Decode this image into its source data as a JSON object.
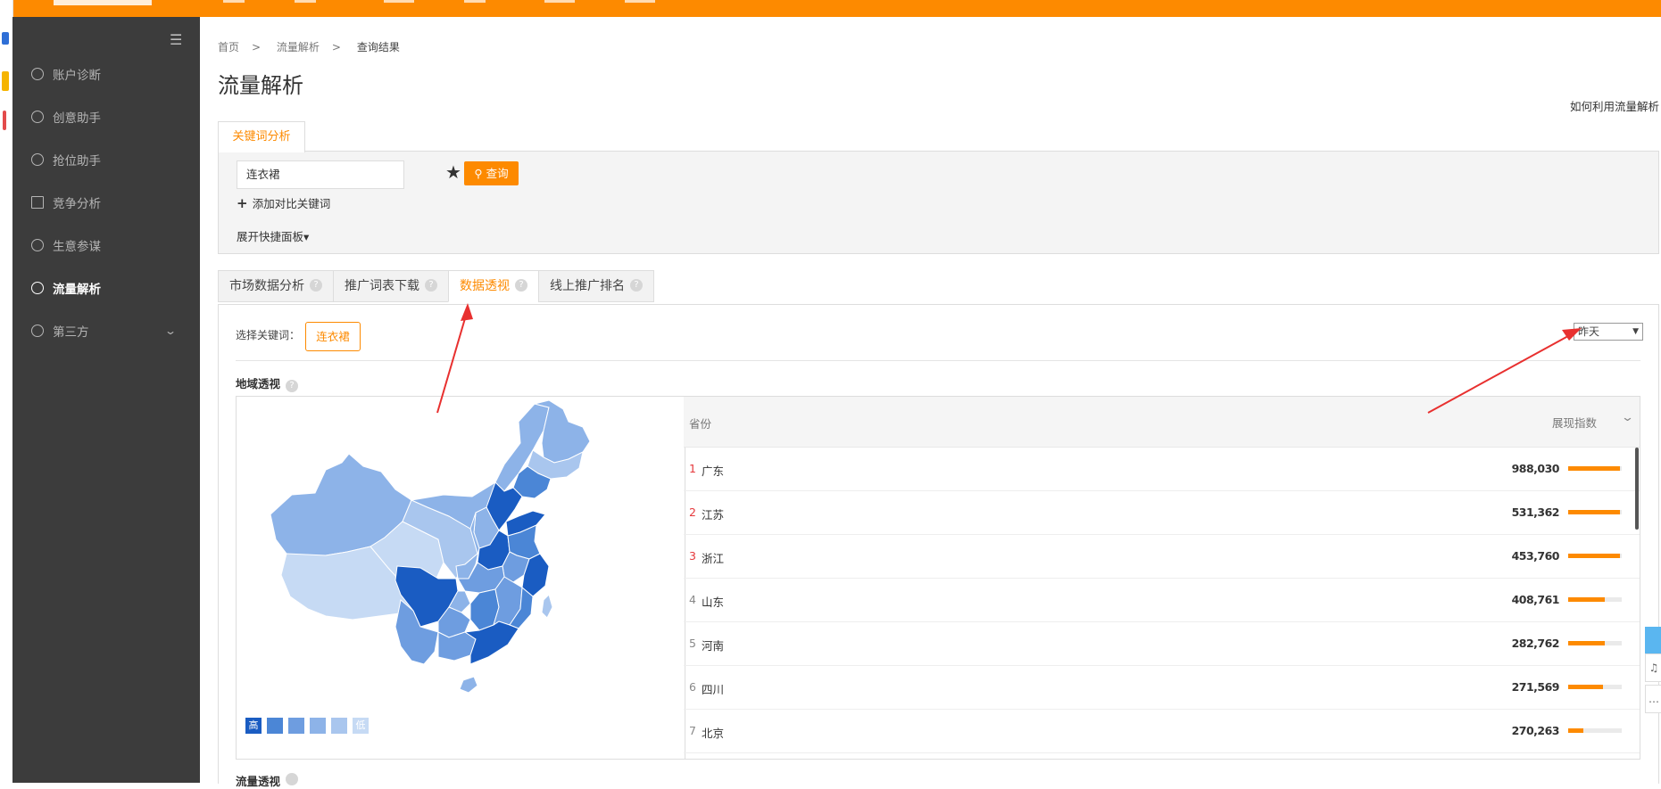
{
  "sidebar": {
    "items": [
      {
        "label": "账户诊断",
        "icon": "diagnosis-icon"
      },
      {
        "label": "创意助手",
        "icon": "bulb-icon"
      },
      {
        "label": "抢位助手",
        "icon": "target-icon"
      },
      {
        "label": "竞争分析",
        "icon": "chart-icon"
      },
      {
        "label": "生意参谋",
        "icon": "compass-icon"
      },
      {
        "label": "流量解析",
        "icon": "flow-icon",
        "active": true
      },
      {
        "label": "第三方",
        "icon": "refresh-icon",
        "expandable": true
      }
    ]
  },
  "breadcrumb": {
    "home": "首页",
    "section": "流量解析",
    "current": "查询结果"
  },
  "page_title": "流量解析",
  "help_link": "如何利用流量解析",
  "keyword_tab": "关键词分析",
  "search": {
    "value": "连衣裙",
    "button": "查询",
    "add_compare": "添加对比关键词",
    "expand_panel": "展开快捷面板"
  },
  "tabs": [
    {
      "label": "市场数据分析",
      "active": false
    },
    {
      "label": "推广词表下载",
      "active": false
    },
    {
      "label": "数据透视",
      "active": true
    },
    {
      "label": "线上推广排名",
      "active": false
    }
  ],
  "select_keyword": {
    "label": "选择关键词：",
    "chip": "连衣裙"
  },
  "day_select": {
    "value": "昨天"
  },
  "region": {
    "title": "地域透视",
    "legend_high": "高",
    "legend_low": "低",
    "colors": [
      "#1a5cc2",
      "#4b86d6",
      "#6e9de0",
      "#8db3e8",
      "#a9c6ee",
      "#c6daf4"
    ],
    "table_header": {
      "province": "省份",
      "metric": "展现指数"
    },
    "rows": [
      {
        "rank": "1",
        "province": "广东",
        "value": "988,030",
        "ratio": 0.97
      },
      {
        "rank": "2",
        "province": "江苏",
        "value": "531,362",
        "ratio": 0.97
      },
      {
        "rank": "3",
        "province": "浙江",
        "value": "453,760",
        "ratio": 0.97
      },
      {
        "rank": "4",
        "province": "山东",
        "value": "408,761",
        "ratio": 0.68
      },
      {
        "rank": "5",
        "province": "河南",
        "value": "282,762",
        "ratio": 0.68
      },
      {
        "rank": "6",
        "province": "四川",
        "value": "271,569",
        "ratio": 0.65
      },
      {
        "rank": "7",
        "province": "北京",
        "value": "270,263",
        "ratio": 0.28
      }
    ]
  },
  "flow_title": "流量透视"
}
